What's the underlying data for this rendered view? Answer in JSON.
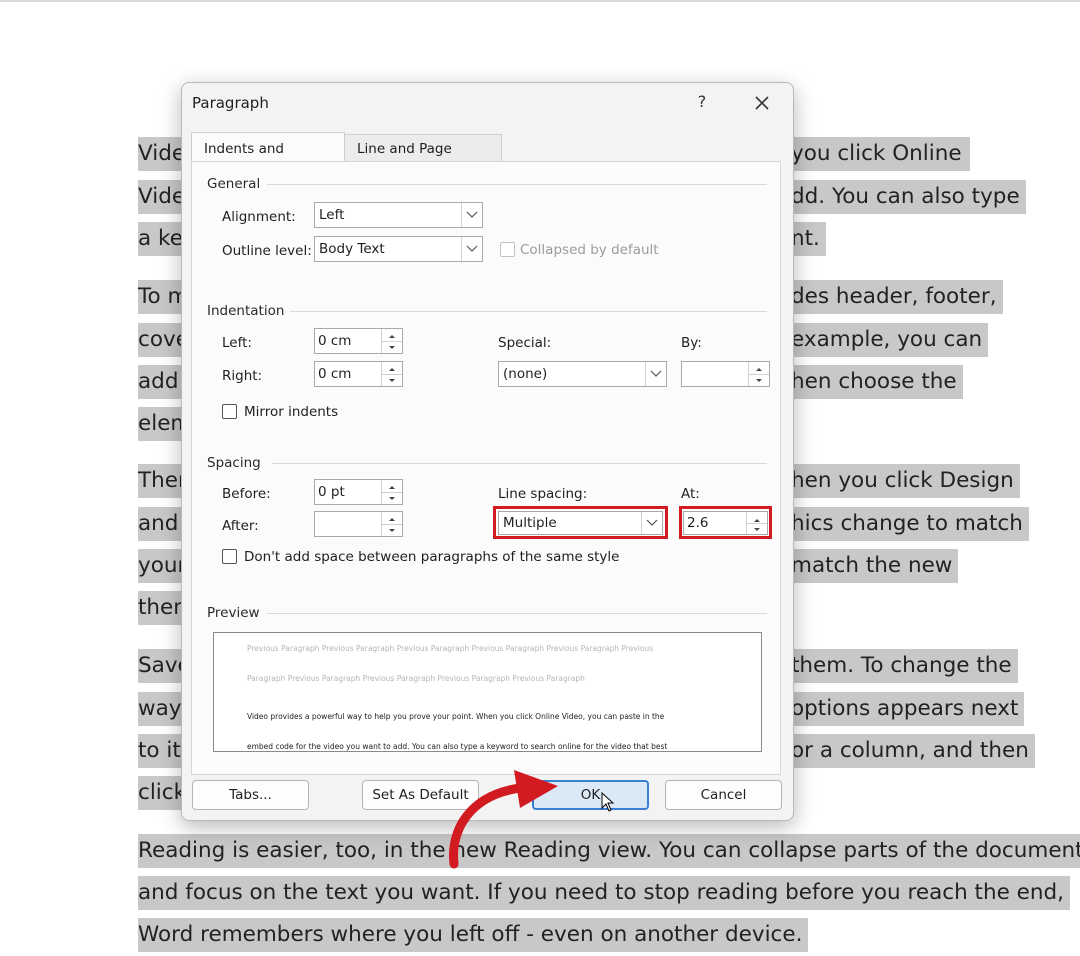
{
  "document": {
    "lines_left": [
      "Vide",
      "Vide",
      "a key",
      "To m",
      "cove",
      "add",
      "elem",
      "Ther",
      "and",
      "your",
      "them",
      "Save",
      "way",
      "to it.",
      "click"
    ],
    "lines_right": [
      "you click Online",
      "dd. You can also type",
      "nt.",
      "des header, footer,",
      "example, you can",
      "hen choose the",
      "hen you click Design",
      "hics change to match",
      "match the new",
      "them. To change the",
      "options appears next",
      "or a column, and then"
    ],
    "full_lines": [
      "Reading is easier, too, in the new Reading view. You can collapse parts of the document",
      "and focus on the text you want. If you need to stop reading before you reach the end,",
      "Word remembers where you left off - even on another device."
    ]
  },
  "dialog": {
    "title": "Paragraph",
    "help": "?",
    "tabs": [
      "Indents and Spacing",
      "Line and Page Breaks"
    ],
    "general": {
      "heading": "General",
      "alignment_label": "Alignment:",
      "alignment_value": "Left",
      "outline_label": "Outline level:",
      "outline_value": "Body Text",
      "collapsed_label": "Collapsed by default"
    },
    "indentation": {
      "heading": "Indentation",
      "left_label": "Left:",
      "left_value": "0 cm",
      "right_label": "Right:",
      "right_value": "0 cm",
      "special_label": "Special:",
      "special_value": "(none)",
      "by_label": "By:",
      "by_value": "",
      "mirror_label": "Mirror indents"
    },
    "spacing": {
      "heading": "Spacing",
      "before_label": "Before:",
      "before_value": "0 pt",
      "after_label": "After:",
      "after_value": "",
      "line_spacing_label": "Line spacing:",
      "line_spacing_value": "Multiple",
      "at_label": "At:",
      "at_value": "2.6",
      "dont_add_label": "Don't add space between paragraphs of the same style"
    },
    "preview": {
      "heading": "Preview",
      "prev_line1": "Previous Paragraph Previous Paragraph Previous Paragraph Previous Paragraph Previous Paragraph Previous",
      "prev_line2": "Paragraph Previous Paragraph Previous Paragraph Previous Paragraph Previous Paragraph",
      "sample_line1": "Video provides a powerful way to help you prove your point. When you click Online Video, you can paste in the",
      "sample_line2": "embed code for the video you want to add. You can also type a keyword to search online for the video that best"
    },
    "buttons": {
      "tabs": "Tabs...",
      "set_default": "Set As Default",
      "ok": "OK",
      "cancel": "Cancel"
    }
  },
  "colors": {
    "highlight_box": "#d21a21",
    "ok_border": "#3b7fd4",
    "doc_highlight": "#c8c8c8"
  }
}
